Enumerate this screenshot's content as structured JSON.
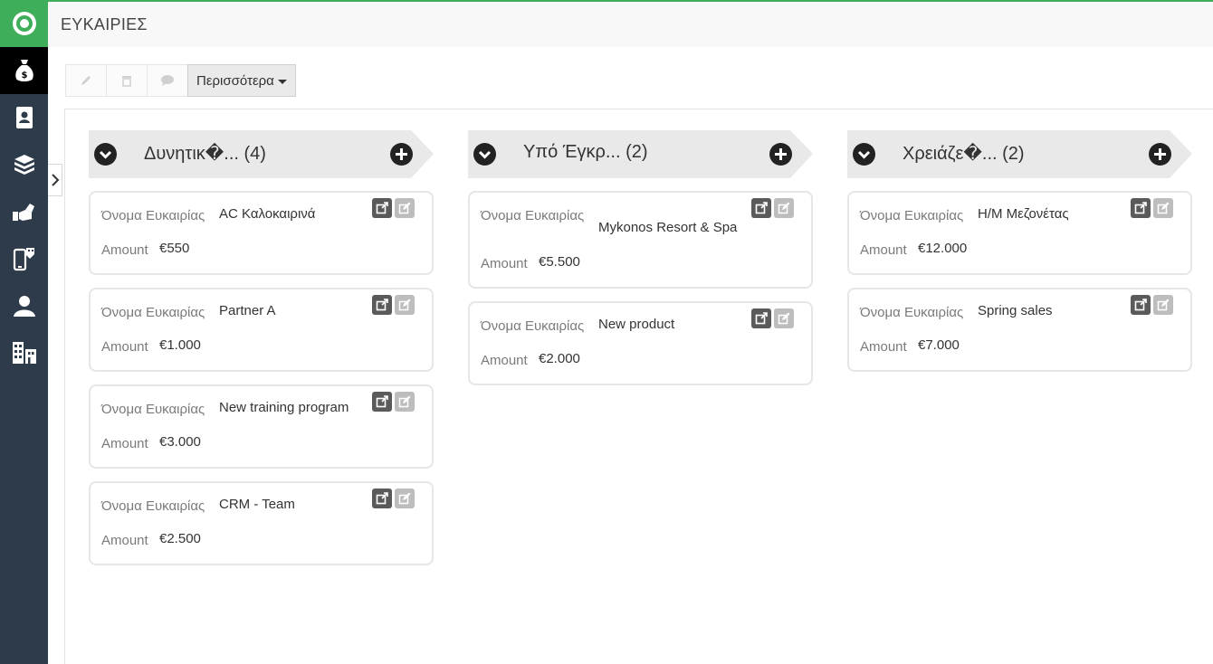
{
  "header": {
    "title": "ΕΥΚΑΙΡΙΕΣ"
  },
  "sidebar": {
    "items": [
      {
        "icon": "money-bag-icon",
        "active": true
      },
      {
        "icon": "contact-book-icon",
        "active": false
      },
      {
        "icon": "boxes-icon",
        "active": false
      },
      {
        "icon": "handshake-icon",
        "active": false
      },
      {
        "icon": "mobile-tag-icon",
        "active": false
      },
      {
        "icon": "user-icon",
        "active": false
      },
      {
        "icon": "buildings-icon",
        "active": false
      }
    ]
  },
  "toolbar": {
    "edit_icon": "pencil-icon",
    "delete_icon": "trash-icon",
    "comment_icon": "comment-icon",
    "more_label": "Περισσότερα"
  },
  "columns": [
    {
      "title": "Δυνητικ�... (4)",
      "cards": [
        {
          "name_label": "Όνομα Ευκαιρίας",
          "name": "AC Καλοκαιρινά",
          "amount_label": "Amount",
          "amount": "€550"
        },
        {
          "name_label": "Όνομα Ευκαιρίας",
          "name": "Partner A",
          "amount_label": "Amount",
          "amount": "€1.000"
        },
        {
          "name_label": "Όνομα Ευκαιρίας",
          "name": "New training program",
          "amount_label": "Amount",
          "amount": "€3.000"
        },
        {
          "name_label": "Όνομα Ευκαιρίας",
          "name": "CRM - Team",
          "amount_label": "Amount",
          "amount": "€2.500"
        }
      ]
    },
    {
      "title": "Υπό Έγκρ... (2)",
      "cards": [
        {
          "name_label": "Όνομα Ευκαιρίας",
          "name": "Mykonos Resort & Spa",
          "amount_label": "Amount",
          "amount": "€5.500"
        },
        {
          "name_label": "Όνομα Ευκαιρίας",
          "name": "New product",
          "amount_label": "Amount",
          "amount": "€2.000"
        }
      ]
    },
    {
      "title": "Χρειάζε�... (2)",
      "cards": [
        {
          "name_label": "Όνομα Ευκαιρίας",
          "name": "Η/Μ Μεζονέτας",
          "amount_label": "Amount",
          "amount": "€12.000"
        },
        {
          "name_label": "Όνομα Ευκαιρίας",
          "name": "Spring sales",
          "amount_label": "Amount",
          "amount": "€7.000"
        }
      ]
    }
  ],
  "colors": {
    "brand_green": "#3fae5a",
    "sidebar": "#2e3b4a",
    "column_header": "#e9e9e9"
  }
}
